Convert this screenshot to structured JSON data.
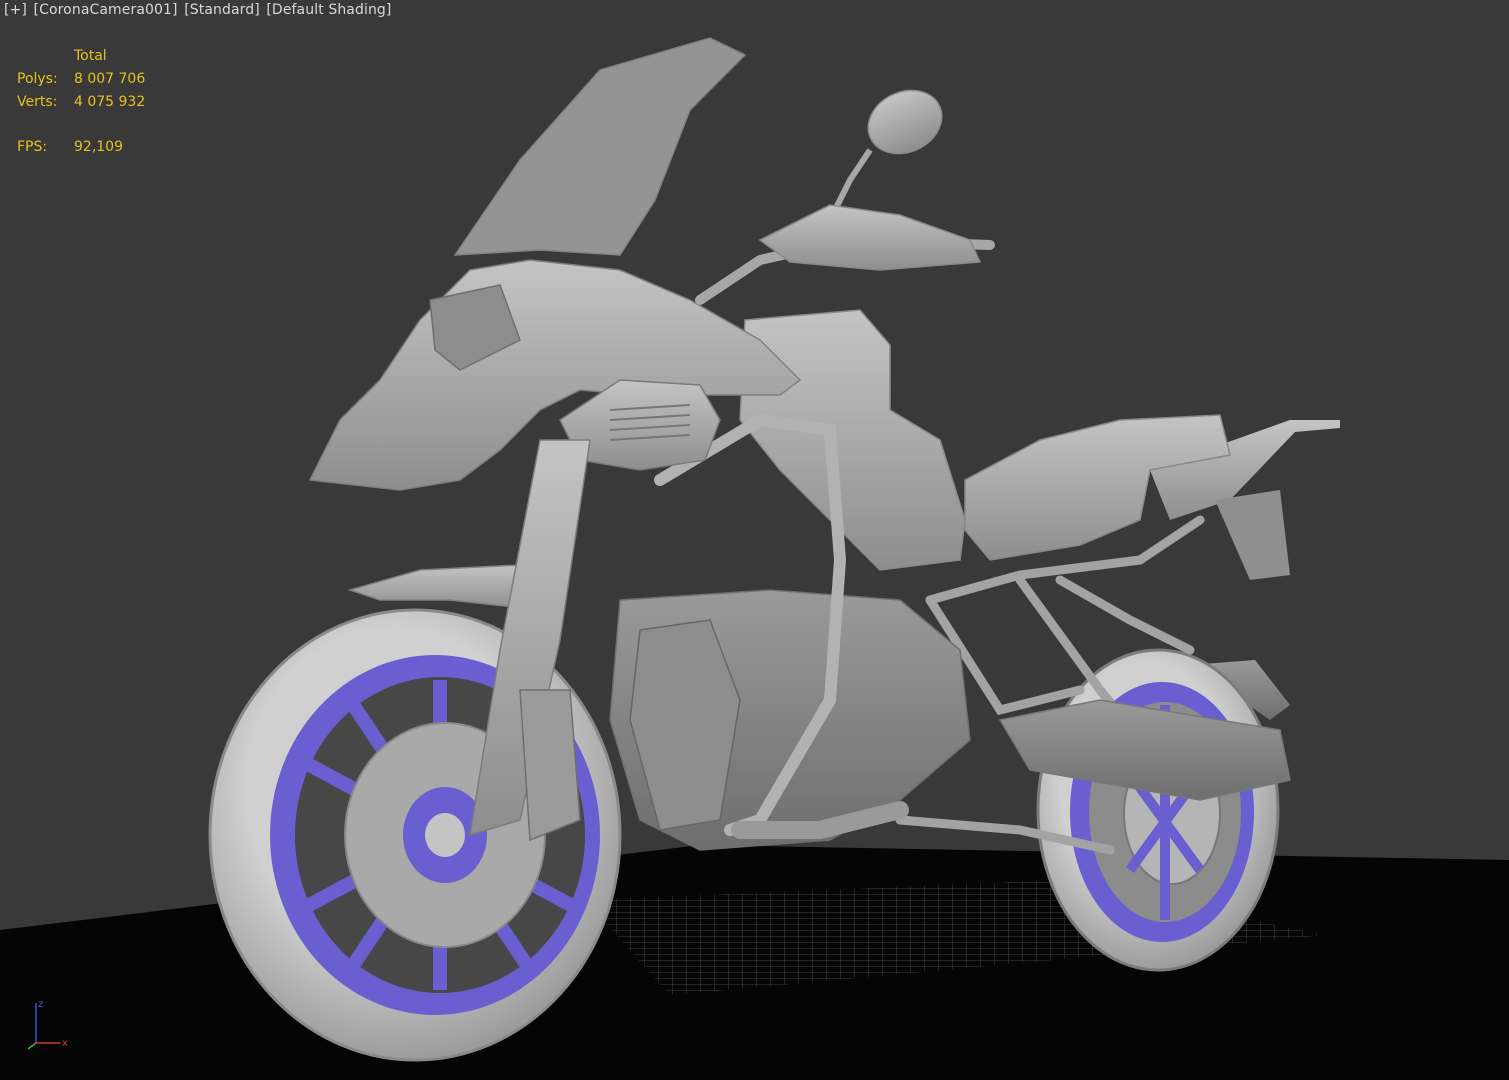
{
  "viewport": {
    "label_parts": [
      "[+]",
      "[CoronaCamera001]",
      "[Standard]",
      "[Default Shading]"
    ]
  },
  "stats": {
    "header": "Total",
    "polys_label": "Polys:",
    "polys_value": "8 007 706",
    "verts_label": "Verts:",
    "verts_value": "4 075 932",
    "fps_label": "FPS:",
    "fps_value": "92,109"
  },
  "axis": {
    "x_label": "x",
    "z_label": "z"
  },
  "colors": {
    "background": "#393939",
    "ground": "#050505",
    "stats_text": "#e6c21a",
    "model_gray": "#a9a9a9",
    "rim_purple": "#6a5fd0"
  },
  "icons": [
    "viewport-gizmo-icon"
  ]
}
